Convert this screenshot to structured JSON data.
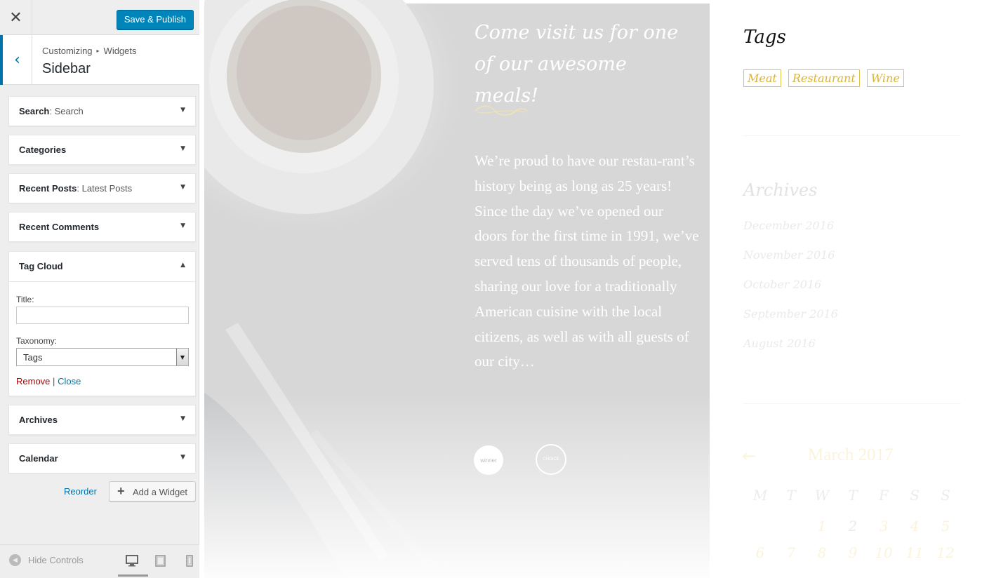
{
  "customizer": {
    "close_glyph": "✕",
    "publish_label": "Save & Publish",
    "back_glyph": "‹",
    "breadcrumb": {
      "root": "Customizing",
      "sep": "▸",
      "current": "Widgets"
    },
    "section_title": "Sidebar",
    "widgets": [
      {
        "title": "Search",
        "subtitle": ": Search"
      },
      {
        "title": "Categories",
        "subtitle": ""
      },
      {
        "title": "Recent Posts",
        "subtitle": ": Latest Posts"
      },
      {
        "title": "Recent Comments",
        "subtitle": ""
      }
    ],
    "tag_cloud": {
      "title": "Tag Cloud",
      "title_label": "Title:",
      "title_value": "",
      "taxonomy_label": "Taxonomy:",
      "taxonomy_value": "Tags",
      "remove_label": "Remove",
      "sep": "|",
      "close_label": "Close"
    },
    "widgets_after": [
      {
        "title": "Archives"
      },
      {
        "title": "Calendar"
      }
    ],
    "reorder_label": "Reorder",
    "add_widget_label": "Add a Widget",
    "add_widget_glyph": "+",
    "hide_controls_label": "Hide Controls",
    "arrow_down": "▼",
    "arrow_up": "▲"
  },
  "hero": {
    "heading": "Come visit us for one of our awesome meals!",
    "body": "We’re proud to have our restau-rant’s history being as long as 25 years! Since the day we’ve opened our doors for the first time in 1991, we’ve served tens of thousands of people, sharing our love for a traditionally American cuisine with the local citizens, as well as with all guests of our city…",
    "badge1": "winner",
    "badge2": "CHOICE"
  },
  "sidebar_preview": {
    "tags_title": "Tags",
    "tags": [
      "Meat",
      "Restaurant",
      "Wine"
    ],
    "tag_color": "#d9b43a",
    "archives_title": "Archives",
    "archives": [
      "December 2016",
      "November 2016",
      "October 2016",
      "September 2016",
      "August 2016"
    ],
    "calendar": {
      "prev_glyph": "←",
      "title": "March 2017",
      "weekdays": [
        "M",
        "T",
        "W",
        "T",
        "F",
        "S",
        "S"
      ],
      "row1": [
        "1",
        "2",
        "3",
        "4",
        "5"
      ],
      "row2": [
        "6",
        "7",
        "8",
        "9",
        "10",
        "11",
        "12"
      ]
    }
  },
  "colors": {
    "accent": "#0085ba",
    "link": "#0073aa",
    "danger": "#aa0000"
  }
}
